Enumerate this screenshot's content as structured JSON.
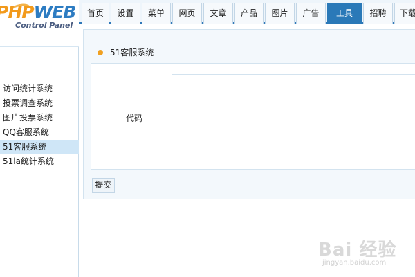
{
  "logo": {
    "brand_part1": "PHP",
    "brand_part2": "WEB",
    "subtitle": "Control Panel"
  },
  "nav": {
    "tabs": [
      {
        "label": "首页",
        "active": false
      },
      {
        "label": "设置",
        "active": false
      },
      {
        "label": "菜单",
        "active": false
      },
      {
        "label": "网页",
        "active": false
      },
      {
        "label": "文章",
        "active": false
      },
      {
        "label": "产品",
        "active": false
      },
      {
        "label": "图片",
        "active": false
      },
      {
        "label": "广告",
        "active": false
      },
      {
        "label": "工具",
        "active": true
      },
      {
        "label": "招聘",
        "active": false
      },
      {
        "label": "下载",
        "active": false
      }
    ]
  },
  "sidebar": {
    "items": [
      {
        "label": "访问统计系统",
        "active": false
      },
      {
        "label": "投票调查系统",
        "active": false
      },
      {
        "label": "图片投票系统",
        "active": false
      },
      {
        "label": "QQ客服系统",
        "active": false
      },
      {
        "label": "51客服系统",
        "active": true
      },
      {
        "label": "51la统计系统",
        "active": false
      }
    ]
  },
  "main": {
    "section_title": "51客服系统",
    "code_label": "代码",
    "code_value": "",
    "submit_label": "提交"
  },
  "watermark": {
    "main": "Bai 经验",
    "sub": "jingyan.baidu.com"
  },
  "colors": {
    "accent": "#2a79b8",
    "active_side": "#cfe6f7",
    "bullet": "#f0a020",
    "brand_orange": "#f29a1c",
    "brand_blue": "#2d7cc2"
  }
}
